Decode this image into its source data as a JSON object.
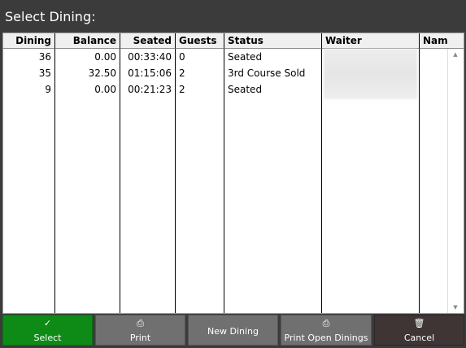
{
  "window": {
    "title": "Select Dining:"
  },
  "columns": {
    "dining": "Dining",
    "balance": "Balance",
    "seated": "Seated",
    "guests": "Guests",
    "status": "Status",
    "waiter": "Waiter",
    "name": "Nam"
  },
  "rows": [
    {
      "dining": "36",
      "balance": "0.00",
      "seated": "00:33:40",
      "guests": "0",
      "status": "Seated"
    },
    {
      "dining": "35",
      "balance": "32.50",
      "seated": "01:15:06",
      "guests": "2",
      "status": "3rd Course Sold"
    },
    {
      "dining": "9",
      "balance": "0.00",
      "seated": "00:21:23",
      "guests": "2",
      "status": "Seated"
    }
  ],
  "buttons": {
    "select": {
      "label": "Select",
      "icon": "checkmark-icon"
    },
    "print": {
      "label": "Print",
      "icon": "printer-icon"
    },
    "new_dining": {
      "label": "New Dining"
    },
    "print_open": {
      "label": "Print Open Dinings",
      "icon": "printer-icon"
    },
    "cancel": {
      "label": "Cancel",
      "icon": "trash-icon"
    }
  },
  "colors": {
    "title_bg": "#3b3b3b",
    "select_button": "#0e8a16",
    "gray_button": "#707070",
    "cancel_button": "#3f3535"
  }
}
